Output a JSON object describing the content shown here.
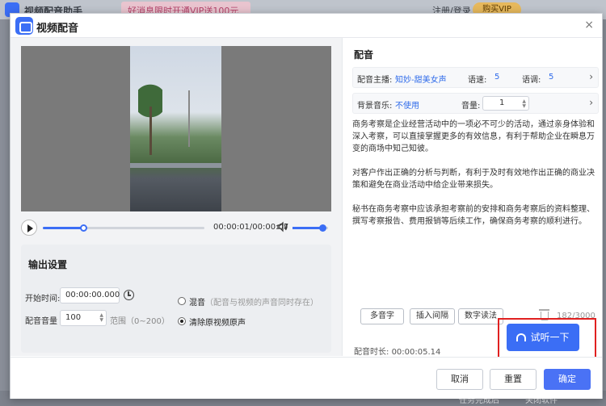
{
  "background": {
    "app_title": "视频配音助手",
    "promo": "好消息限时开通VIP送100元",
    "login": "注册/登录",
    "vip_badge": "购买VIP",
    "status_left": "任务完成后",
    "status_right": "关闭软件"
  },
  "dialog": {
    "title": "视频配音",
    "close_glyph": "×"
  },
  "player": {
    "play_glyph": "▶",
    "progress": 0.25,
    "timecode": "00:00:01/00:00:07",
    "volume": 0.85
  },
  "output": {
    "title": "输出设置",
    "start_label": "开始时间:",
    "start_value": "00:00:00.000",
    "volume_label": "配音音量",
    "volume_value": "100",
    "range_label": "范围（0~200）",
    "mix_label": "混音",
    "mix_note": "（配音与视频的声音同时存在）",
    "clear_label": "清除原视频原声",
    "selected_mode": "clear"
  },
  "dubbing": {
    "title": "配音",
    "anchor_label": "配音主播:",
    "anchor_value": "知妙-甜美女声",
    "speed_label": "语速:",
    "speed_value": "5",
    "pitch_label": "语调:",
    "pitch_value": "5",
    "bgm_label": "背景音乐:",
    "bgm_value": "不使用",
    "bgm_volume_label": "音量:",
    "bgm_volume_value": "1",
    "chevron": "›",
    "paragraphs": [
      "商务考察是企业经营活动中的一项必不可少的活动，通过亲身体验和深入考察，可以直接掌握更多的有效信息，有利于帮助企业在瞬息万变的商场中知己知彼。",
      "对客户作出正确的分析与判断，有利于及时有效地作出正确的商业决策和避免在商业活动中给企业带来损失。",
      "秘书在商务考察中应该承担考察前的安排和商务考察后的资料整理、撰写考察报告、费用报销等后续工作，确保商务考察的顺利进行。"
    ],
    "tools": [
      "多音字",
      "插入间隔",
      "数字读法"
    ],
    "char_count": "182/3000",
    "duration_label": "配音时长:",
    "duration_value": "00:00:05.14",
    "listen_label": "试听一下"
  },
  "footer": {
    "cancel": "取消",
    "reset": "重置",
    "confirm": "确定"
  }
}
